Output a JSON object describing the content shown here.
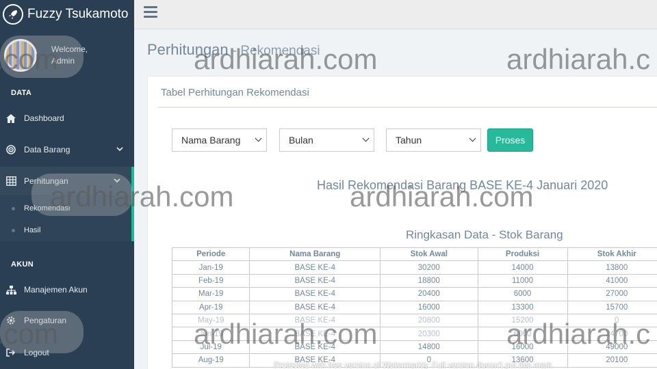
{
  "brand": {
    "title": "Fuzzy Tsukamoto"
  },
  "profile": {
    "welcome": "Welcome,",
    "name": "Admin"
  },
  "sidebar": {
    "section_data": "DATA",
    "section_akun": "AKUN",
    "items": [
      {
        "label": "Dashboard",
        "icon": "home-icon"
      },
      {
        "label": "Data Barang",
        "icon": "target-icon"
      },
      {
        "label": "Perhitungan",
        "icon": "table-icon"
      },
      {
        "label": "Manajemen Akun",
        "icon": "sitemap-icon"
      },
      {
        "label": "Pengaturan",
        "icon": "gear-icon"
      },
      {
        "label": "Logout",
        "icon": "logout-icon"
      }
    ],
    "subitems": [
      {
        "label": "Rekomendasi"
      },
      {
        "label": "Hasil"
      }
    ]
  },
  "page": {
    "title": "Perhitungan",
    "subtitle": "Rekomendasi"
  },
  "panel": {
    "title": "Tabel Perhitungan Rekomendasi",
    "filters": {
      "barang": "Nama Barang",
      "bulan": "Bulan",
      "tahun": "Tahun"
    },
    "button": "Proses",
    "result_title": "Hasil Rekomendasi Barang BASE KE-4 Januari 2020",
    "summary_title": "Ringkasan Data - Stok Barang"
  },
  "table": {
    "headers": [
      "Periode",
      "Nama Barang",
      "Stok Awal",
      "Produksi",
      "Stok Akhir"
    ],
    "rows": [
      [
        "Jan-19",
        "BASE KE-4",
        "30200",
        "14000",
        "13800"
      ],
      [
        "Feb-19",
        "BASE KE-4",
        "18800",
        "11000",
        "41000"
      ],
      [
        "Mar-19",
        "BASE KE-4",
        "20400",
        "6000",
        "27000"
      ],
      [
        "Apr-19",
        "BASE KE-4",
        "16000",
        "13300",
        "15700"
      ],
      [
        "May-19",
        "BASE KE-4",
        "20800",
        "15200",
        "0"
      ],
      [
        "Jun-19",
        "BASE KE-4",
        "20300",
        "6000",
        "24700"
      ],
      [
        "Jul-19",
        "BASE KE-4",
        "14800",
        "16000",
        "49000"
      ],
      [
        "Aug-19",
        "BASE KE-4",
        "0",
        "13600",
        "20100"
      ]
    ]
  },
  "watermark": {
    "text": "ardhiarah.com",
    "partial_left": ".com",
    "partial_right": "ardhiarah.c",
    "notice": "Protected with free version of Watermarkly. Full version doesn't put this mark."
  }
}
